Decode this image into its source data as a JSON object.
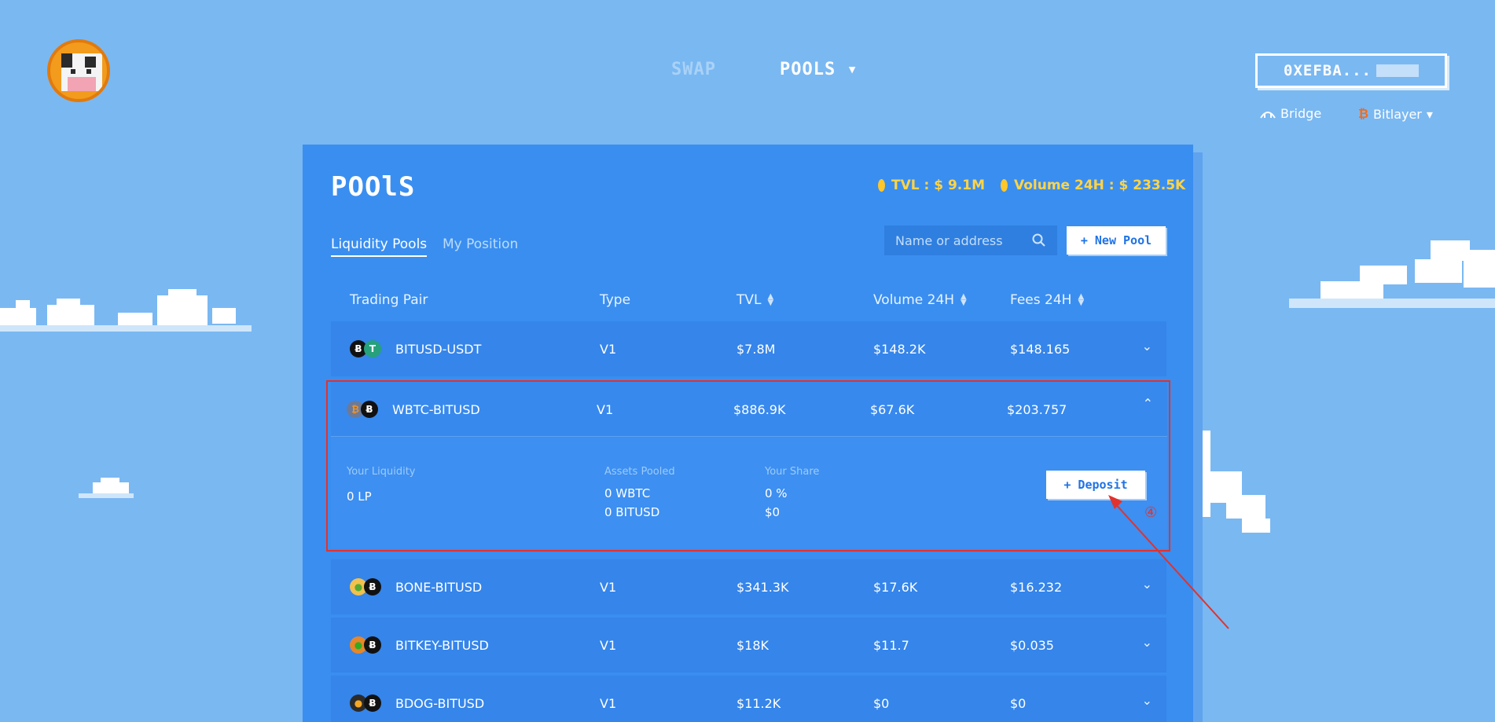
{
  "nav": {
    "swap": "SWAP",
    "pools": "POOLS",
    "pools_caret": "▾"
  },
  "wallet": {
    "address": "0XEFBA..."
  },
  "network": {
    "bridge": "Bridge",
    "chain": "Bitlayer",
    "chain_caret": "▾"
  },
  "panel": {
    "title": "POOlS",
    "tvl": "TVL : $ 9.1M",
    "volume": "Volume 24H : $ 233.5K",
    "tabs": {
      "liquidity": "Liquidity Pools",
      "position": "My Position"
    },
    "search_placeholder": "Name or address",
    "new_pool": "+ New Pool"
  },
  "table": {
    "headers": {
      "pair": "Trading Pair",
      "type": "Type",
      "tvl": "TVL",
      "volume": "Volume 24H",
      "fees": "Fees 24H"
    },
    "rows": [
      {
        "pair": "BITUSD-USDT",
        "type": "V1",
        "tvl": "$7.8M",
        "volume": "$148.2K",
        "fees": "$148.165"
      },
      {
        "pair": "WBTC-BITUSD",
        "type": "V1",
        "tvl": "$886.9K",
        "volume": "$67.6K",
        "fees": "$203.757"
      },
      {
        "pair": "BONE-BITUSD",
        "type": "V1",
        "tvl": "$341.3K",
        "volume": "$17.6K",
        "fees": "$16.232"
      },
      {
        "pair": "BITKEY-BITUSD",
        "type": "V1",
        "tvl": "$18K",
        "volume": "$11.7",
        "fees": "$0.035"
      },
      {
        "pair": "BDOG-BITUSD",
        "type": "V1",
        "tvl": "$11.2K",
        "volume": "$0",
        "fees": "$0"
      }
    ]
  },
  "expanded": {
    "your_liquidity_label": "Your Liquidity",
    "your_liquidity_value": "0 LP",
    "assets_label": "Assets Pooled",
    "assets_1": "0 WBTC",
    "assets_2": "0 BITUSD",
    "share_label": "Your Share",
    "share_1": "0 %",
    "share_2": "$0",
    "deposit": "+ Deposit"
  },
  "annotation": "④",
  "colors": {
    "background": "#7ab8f2",
    "panel": "#3a8ef0",
    "accent": "#ffd447",
    "highlight": "#e2322d"
  }
}
